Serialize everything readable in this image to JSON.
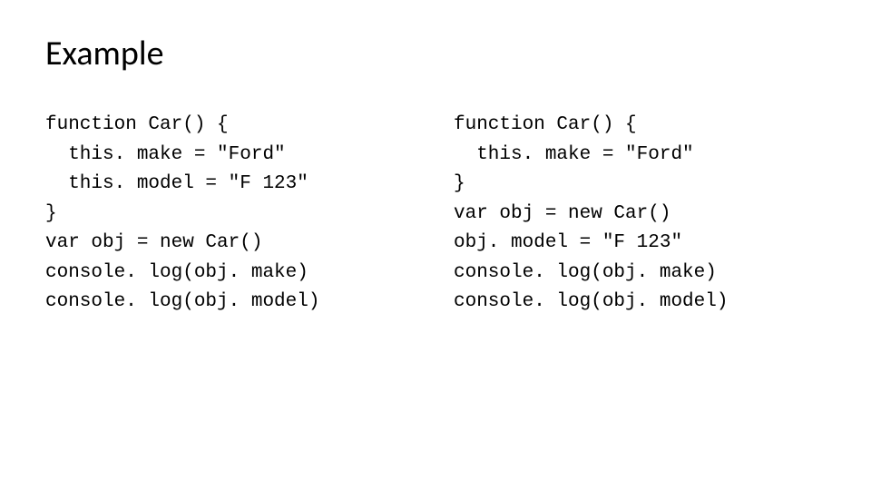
{
  "title": "Example",
  "left_code": "function Car() {\n  this. make = \"Ford\"\n  this. model = \"F 123\"\n}\nvar obj = new Car()\nconsole. log(obj. make)\nconsole. log(obj. model)",
  "right_code": "function Car() {\n  this. make = \"Ford\"\n}\nvar obj = new Car()\nobj. model = \"F 123\"\nconsole. log(obj. make)\nconsole. log(obj. model)"
}
